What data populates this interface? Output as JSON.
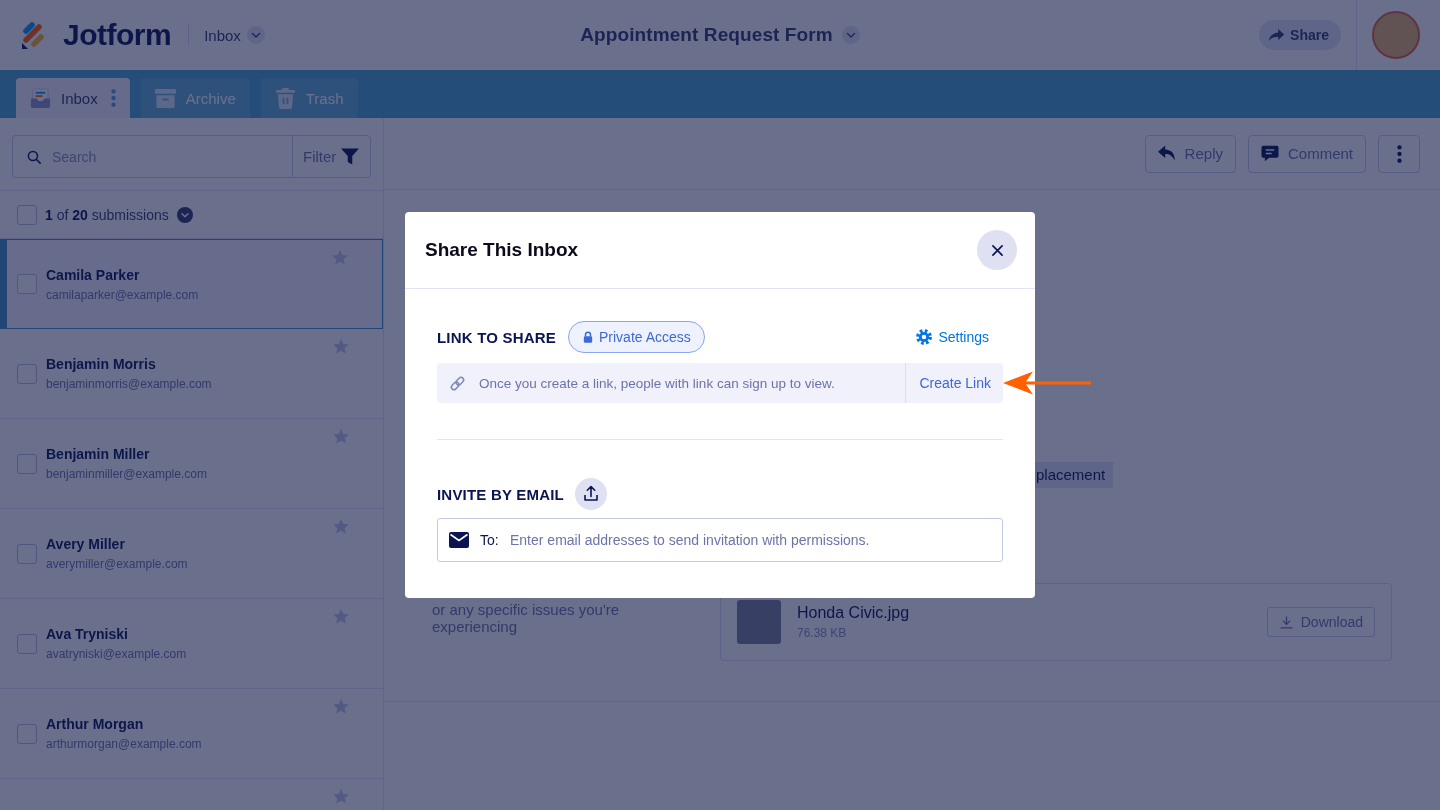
{
  "header": {
    "logo": "Jotform",
    "section": "Inbox",
    "form_title": "Appointment Request Form",
    "share_button": "Share"
  },
  "tabs": [
    {
      "kind": "inbox",
      "label": "Inbox",
      "selected": true
    },
    {
      "kind": "archive",
      "label": "Archive",
      "selected": false
    },
    {
      "kind": "trash",
      "label": "Trash",
      "selected": false
    }
  ],
  "sidebar": {
    "search": {
      "placeholder": "Search"
    },
    "filter_button": "Filter",
    "select_all_checked": false,
    "selection_summary": "**1** of **20** submissions",
    "submissions": [
      {
        "name": "Camila Parker",
        "email": "camilaparker@example.com",
        "selected": true,
        "checked": false,
        "starred": false
      },
      {
        "name": "Benjamin Morris",
        "email": "benjaminmorris@example.com",
        "selected": false,
        "checked": false,
        "starred": false
      },
      {
        "name": "Benjamin Miller",
        "email": "benjaminmiller@example.com",
        "selected": false,
        "checked": false,
        "starred": false
      },
      {
        "name": "Avery Miller",
        "email": "averymiller@example.com",
        "selected": false,
        "checked": false,
        "starred": false
      },
      {
        "name": "Ava Tryniski",
        "email": "avatryniski@example.com",
        "selected": false,
        "checked": false,
        "starred": false
      },
      {
        "name": "Arthur Morgan",
        "email": "arthurmorgan@example.com",
        "selected": false,
        "checked": false,
        "starred": false
      },
      {
        "selected": false,
        "starred": false
      }
    ]
  },
  "toolbar": {
    "buttons": [
      {
        "kind": "reply",
        "label": "Reply"
      },
      {
        "kind": "comment",
        "label": "Comment"
      },
      {
        "kind": "more"
      }
    ]
  },
  "submission_view": {
    "tag": "placement",
    "field_text": "or any specific issues you're experiencing",
    "attachment": {
      "file_name": "Honda Civic.jpg",
      "file_size": "76.38 KB",
      "download_button": "Download"
    }
  },
  "modal": {
    "title": "Share This Inbox",
    "link_section": {
      "heading": "LINK TO SHARE",
      "access_badge": "Private Access",
      "settings_button": "Settings",
      "hint": "Once you create a link, people with link can sign up to view.",
      "create_link_button": "Create Link"
    },
    "invite_section": {
      "heading": "INVITE BY EMAIL",
      "to_label": "To:",
      "placeholder": "Enter email addresses to send invitation with permissions."
    }
  }
}
